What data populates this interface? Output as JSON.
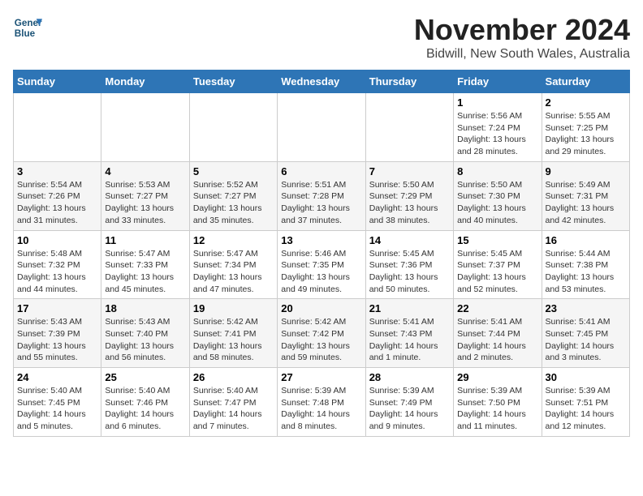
{
  "logo": {
    "line1": "General",
    "line2": "Blue"
  },
  "title": "November 2024",
  "location": "Bidwill, New South Wales, Australia",
  "weekdays": [
    "Sunday",
    "Monday",
    "Tuesday",
    "Wednesday",
    "Thursday",
    "Friday",
    "Saturday"
  ],
  "weeks": [
    [
      {
        "day": "",
        "info": ""
      },
      {
        "day": "",
        "info": ""
      },
      {
        "day": "",
        "info": ""
      },
      {
        "day": "",
        "info": ""
      },
      {
        "day": "",
        "info": ""
      },
      {
        "day": "1",
        "info": "Sunrise: 5:56 AM\nSunset: 7:24 PM\nDaylight: 13 hours and 28 minutes."
      },
      {
        "day": "2",
        "info": "Sunrise: 5:55 AM\nSunset: 7:25 PM\nDaylight: 13 hours and 29 minutes."
      }
    ],
    [
      {
        "day": "3",
        "info": "Sunrise: 5:54 AM\nSunset: 7:26 PM\nDaylight: 13 hours and 31 minutes."
      },
      {
        "day": "4",
        "info": "Sunrise: 5:53 AM\nSunset: 7:27 PM\nDaylight: 13 hours and 33 minutes."
      },
      {
        "day": "5",
        "info": "Sunrise: 5:52 AM\nSunset: 7:27 PM\nDaylight: 13 hours and 35 minutes."
      },
      {
        "day": "6",
        "info": "Sunrise: 5:51 AM\nSunset: 7:28 PM\nDaylight: 13 hours and 37 minutes."
      },
      {
        "day": "7",
        "info": "Sunrise: 5:50 AM\nSunset: 7:29 PM\nDaylight: 13 hours and 38 minutes."
      },
      {
        "day": "8",
        "info": "Sunrise: 5:50 AM\nSunset: 7:30 PM\nDaylight: 13 hours and 40 minutes."
      },
      {
        "day": "9",
        "info": "Sunrise: 5:49 AM\nSunset: 7:31 PM\nDaylight: 13 hours and 42 minutes."
      }
    ],
    [
      {
        "day": "10",
        "info": "Sunrise: 5:48 AM\nSunset: 7:32 PM\nDaylight: 13 hours and 44 minutes."
      },
      {
        "day": "11",
        "info": "Sunrise: 5:47 AM\nSunset: 7:33 PM\nDaylight: 13 hours and 45 minutes."
      },
      {
        "day": "12",
        "info": "Sunrise: 5:47 AM\nSunset: 7:34 PM\nDaylight: 13 hours and 47 minutes."
      },
      {
        "day": "13",
        "info": "Sunrise: 5:46 AM\nSunset: 7:35 PM\nDaylight: 13 hours and 49 minutes."
      },
      {
        "day": "14",
        "info": "Sunrise: 5:45 AM\nSunset: 7:36 PM\nDaylight: 13 hours and 50 minutes."
      },
      {
        "day": "15",
        "info": "Sunrise: 5:45 AM\nSunset: 7:37 PM\nDaylight: 13 hours and 52 minutes."
      },
      {
        "day": "16",
        "info": "Sunrise: 5:44 AM\nSunset: 7:38 PM\nDaylight: 13 hours and 53 minutes."
      }
    ],
    [
      {
        "day": "17",
        "info": "Sunrise: 5:43 AM\nSunset: 7:39 PM\nDaylight: 13 hours and 55 minutes."
      },
      {
        "day": "18",
        "info": "Sunrise: 5:43 AM\nSunset: 7:40 PM\nDaylight: 13 hours and 56 minutes."
      },
      {
        "day": "19",
        "info": "Sunrise: 5:42 AM\nSunset: 7:41 PM\nDaylight: 13 hours and 58 minutes."
      },
      {
        "day": "20",
        "info": "Sunrise: 5:42 AM\nSunset: 7:42 PM\nDaylight: 13 hours and 59 minutes."
      },
      {
        "day": "21",
        "info": "Sunrise: 5:41 AM\nSunset: 7:43 PM\nDaylight: 14 hours and 1 minute."
      },
      {
        "day": "22",
        "info": "Sunrise: 5:41 AM\nSunset: 7:44 PM\nDaylight: 14 hours and 2 minutes."
      },
      {
        "day": "23",
        "info": "Sunrise: 5:41 AM\nSunset: 7:45 PM\nDaylight: 14 hours and 3 minutes."
      }
    ],
    [
      {
        "day": "24",
        "info": "Sunrise: 5:40 AM\nSunset: 7:45 PM\nDaylight: 14 hours and 5 minutes."
      },
      {
        "day": "25",
        "info": "Sunrise: 5:40 AM\nSunset: 7:46 PM\nDaylight: 14 hours and 6 minutes."
      },
      {
        "day": "26",
        "info": "Sunrise: 5:40 AM\nSunset: 7:47 PM\nDaylight: 14 hours and 7 minutes."
      },
      {
        "day": "27",
        "info": "Sunrise: 5:39 AM\nSunset: 7:48 PM\nDaylight: 14 hours and 8 minutes."
      },
      {
        "day": "28",
        "info": "Sunrise: 5:39 AM\nSunset: 7:49 PM\nDaylight: 14 hours and 9 minutes."
      },
      {
        "day": "29",
        "info": "Sunrise: 5:39 AM\nSunset: 7:50 PM\nDaylight: 14 hours and 11 minutes."
      },
      {
        "day": "30",
        "info": "Sunrise: 5:39 AM\nSunset: 7:51 PM\nDaylight: 14 hours and 12 minutes."
      }
    ]
  ]
}
